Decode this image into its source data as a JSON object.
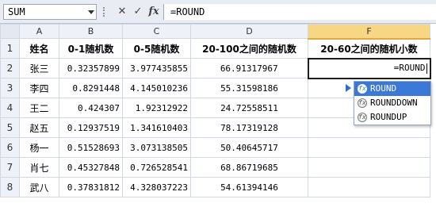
{
  "formula_bar": {
    "name_box": "SUM",
    "cancel_label": "✕",
    "enter_label": "✓",
    "fx_label": "fx",
    "formula": "=ROUND"
  },
  "columns": [
    "A",
    "B",
    "C",
    "D",
    "E",
    "F"
  ],
  "selected_column": "F",
  "header_row": {
    "num": "1",
    "cells": [
      "姓名",
      "0-1随机数",
      "0-5随机数",
      "20-100之间的随机数",
      "20-60之间的随机小数"
    ]
  },
  "rows": [
    {
      "num": "2",
      "name": "张三",
      "b": "0.32357899",
      "c": "3.977435855",
      "d": "66.91317967",
      "f": "=ROUND"
    },
    {
      "num": "3",
      "name": "李四",
      "b": "0.8291448",
      "c": "4.145010236",
      "d": "55.31598186",
      "f": ""
    },
    {
      "num": "4",
      "name": "王二",
      "b": "0.424307",
      "c": "1.92312922",
      "d": "24.72558511",
      "f": ""
    },
    {
      "num": "5",
      "name": "赵五",
      "b": "0.12937519",
      "c": "1.341610403",
      "d": "78.17319128",
      "f": ""
    },
    {
      "num": "6",
      "name": "杨一",
      "b": "0.51528693",
      "c": "3.073138505",
      "d": "50.40645717",
      "f": ""
    },
    {
      "num": "7",
      "name": "肖七",
      "b": "0.45327848",
      "c": "0.726528541",
      "d": "68.86719685",
      "f": ""
    },
    {
      "num": "8",
      "name": "武八",
      "b": "0.37831812",
      "c": "4.328037223",
      "d": "54.61394146",
      "f": ""
    }
  ],
  "autocomplete": {
    "items": [
      "ROUND",
      "ROUNDDOWN",
      "ROUNDUP"
    ],
    "selected_index": 0,
    "icon_label": "fx"
  }
}
